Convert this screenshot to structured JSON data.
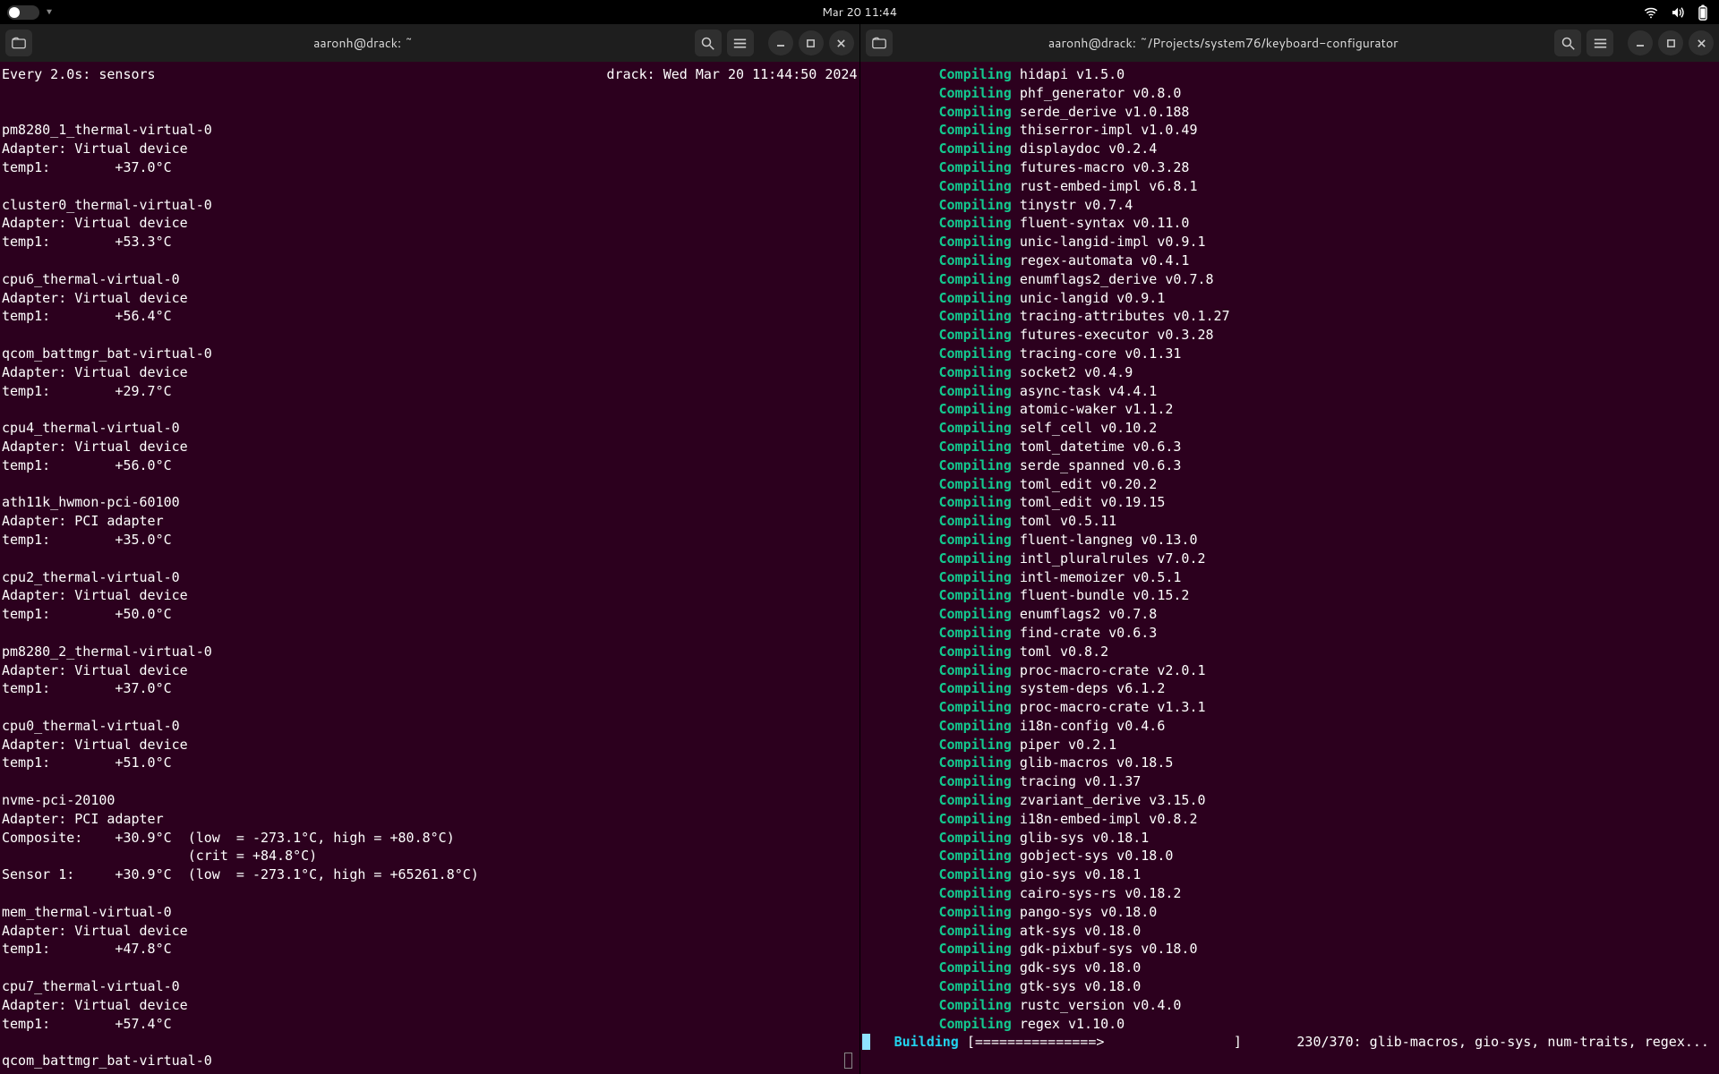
{
  "topbar": {
    "clock": "Mar 20  11:44"
  },
  "left": {
    "title": "aaronh@drack: ~",
    "watch_header_left": "Every 2.0s: sensors",
    "watch_header_right": "drack: Wed Mar 20 11:44:50 2024",
    "sensors": [
      {
        "name": "pm8280_1_thermal-virtual-0",
        "adapter": "Adapter: Virtual device",
        "lines": [
          "temp1:        +37.0°C"
        ]
      },
      {
        "name": "cluster0_thermal-virtual-0",
        "adapter": "Adapter: Virtual device",
        "lines": [
          "temp1:        +53.3°C"
        ]
      },
      {
        "name": "cpu6_thermal-virtual-0",
        "adapter": "Adapter: Virtual device",
        "lines": [
          "temp1:        +56.4°C"
        ]
      },
      {
        "name": "qcom_battmgr_bat-virtual-0",
        "adapter": "Adapter: Virtual device",
        "lines": [
          "temp1:        +29.7°C"
        ]
      },
      {
        "name": "cpu4_thermal-virtual-0",
        "adapter": "Adapter: Virtual device",
        "lines": [
          "temp1:        +56.0°C"
        ]
      },
      {
        "name": "ath11k_hwmon-pci-60100",
        "adapter": "Adapter: PCI adapter",
        "lines": [
          "temp1:        +35.0°C"
        ]
      },
      {
        "name": "cpu2_thermal-virtual-0",
        "adapter": "Adapter: Virtual device",
        "lines": [
          "temp1:        +50.0°C"
        ]
      },
      {
        "name": "pm8280_2_thermal-virtual-0",
        "adapter": "Adapter: Virtual device",
        "lines": [
          "temp1:        +37.0°C"
        ]
      },
      {
        "name": "cpu0_thermal-virtual-0",
        "adapter": "Adapter: Virtual device",
        "lines": [
          "temp1:        +51.0°C"
        ]
      },
      {
        "name": "nvme-pci-20100",
        "adapter": "Adapter: PCI adapter",
        "lines": [
          "Composite:    +30.9°C  (low  = -273.1°C, high = +80.8°C)",
          "                       (crit = +84.8°C)",
          "Sensor 1:     +30.9°C  (low  = -273.1°C, high = +65261.8°C)"
        ]
      },
      {
        "name": "mem_thermal-virtual-0",
        "adapter": "Adapter: Virtual device",
        "lines": [
          "temp1:        +47.8°C"
        ]
      },
      {
        "name": "cpu7_thermal-virtual-0",
        "adapter": "Adapter: Virtual device",
        "lines": [
          "temp1:        +57.4°C"
        ]
      },
      {
        "name": "qcom_battmgr_bat-virtual-0",
        "adapter": "",
        "lines": []
      }
    ]
  },
  "right": {
    "title": "aaronh@drack: ~/Projects/system76/keyboard-configurator",
    "compiling": [
      "hidapi v1.5.0",
      "phf_generator v0.8.0",
      "serde_derive v1.0.188",
      "thiserror-impl v1.0.49",
      "displaydoc v0.2.4",
      "futures-macro v0.3.28",
      "rust-embed-impl v6.8.1",
      "tinystr v0.7.4",
      "fluent-syntax v0.11.0",
      "unic-langid-impl v0.9.1",
      "regex-automata v0.4.1",
      "enumflags2_derive v0.7.8",
      "unic-langid v0.9.1",
      "tracing-attributes v0.1.27",
      "futures-executor v0.3.28",
      "tracing-core v0.1.31",
      "socket2 v0.4.9",
      "async-task v4.4.1",
      "atomic-waker v1.1.2",
      "self_cell v0.10.2",
      "toml_datetime v0.6.3",
      "serde_spanned v0.6.3",
      "toml_edit v0.20.2",
      "toml_edit v0.19.15",
      "toml v0.5.11",
      "fluent-langneg v0.13.0",
      "intl_pluralrules v7.0.2",
      "intl-memoizer v0.5.1",
      "fluent-bundle v0.15.2",
      "enumflags2 v0.7.8",
      "find-crate v0.6.3",
      "toml v0.8.2",
      "proc-macro-crate v2.0.1",
      "system-deps v6.1.2",
      "proc-macro-crate v1.3.1",
      "i18n-config v0.4.6",
      "piper v0.2.1",
      "glib-macros v0.18.5",
      "tracing v0.1.37",
      "zvariant_derive v3.15.0",
      "i18n-embed-impl v0.8.2",
      "glib-sys v0.18.1",
      "gobject-sys v0.18.0",
      "gio-sys v0.18.1",
      "cairo-sys-rs v0.18.2",
      "pango-sys v0.18.0",
      "atk-sys v0.18.0",
      "gdk-pixbuf-sys v0.18.0",
      "gdk-sys v0.18.0",
      "gtk-sys v0.18.0",
      "rustc_version v0.4.0",
      "regex v1.10.0"
    ],
    "building_label": "Building",
    "building_bar": "[===============>                ]",
    "building_progress": "230/370: glib-macros, gio-sys, num-traits, regex..."
  }
}
